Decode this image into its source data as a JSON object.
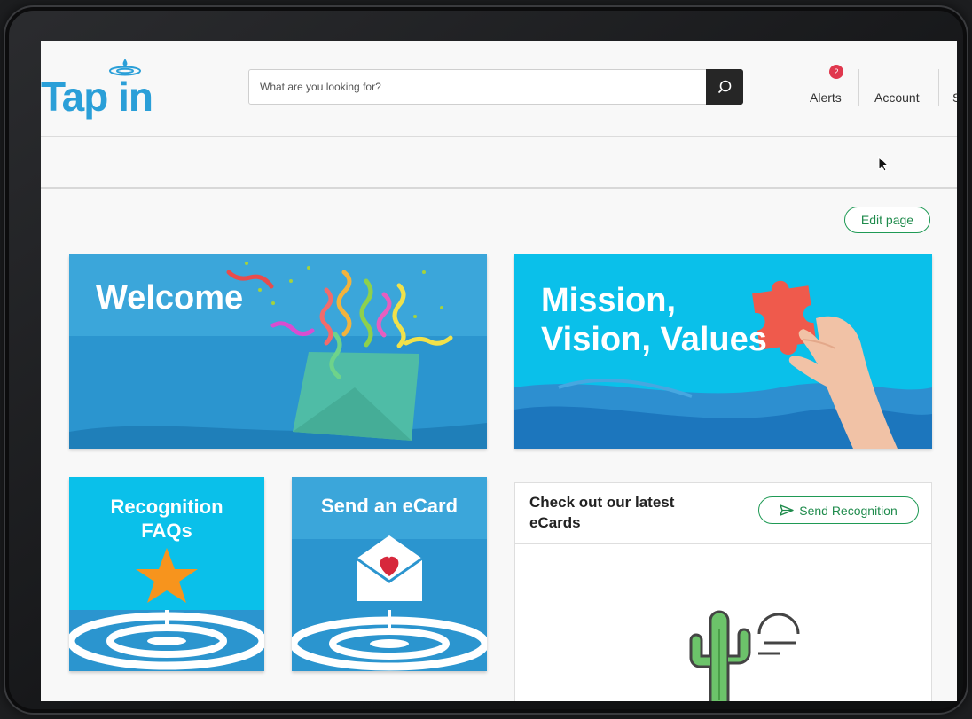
{
  "header": {
    "logo_text": "Tap in",
    "search": {
      "placeholder": "What are you looking for?",
      "value": ""
    },
    "nav": {
      "alerts_label": "Alerts",
      "alerts_count": "2",
      "account_label": "Account",
      "overflow_label": "S"
    }
  },
  "toolbar": {
    "edit_page_label": "Edit page"
  },
  "tiles": {
    "welcome": "Welcome",
    "mission_line1": "Mission,",
    "mission_line2": "Vision, Values",
    "recognition_line1": "Recognition",
    "recognition_line2": "FAQs",
    "ecard": "Send an eCard"
  },
  "ecards_card": {
    "title": "Check out our latest eCards",
    "send_recognition_label": "Send Recognition"
  },
  "colors": {
    "brand_blue": "#2a9fd8",
    "tile_blue": "#2ba7de",
    "green_accent": "#1f9a55",
    "badge_red": "#e0384e"
  }
}
